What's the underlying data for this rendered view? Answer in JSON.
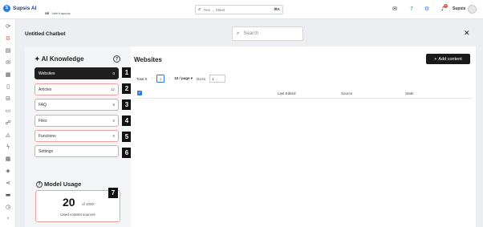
{
  "topbar": {
    "brand": "Supsis AI",
    "workspace_prefix": "SE",
    "workspace_name": "Vale Kapsula",
    "search_placeholder": "Yeni → Etiket",
    "search_shortcut": "⌘K",
    "notification_count": "8",
    "username": "Supsis"
  },
  "page": {
    "title": "Untitled Chatbot",
    "search_placeholder": "Search"
  },
  "knowledge": {
    "title": "AI Knowledge",
    "items": [
      {
        "label": "Websites",
        "count": "0"
      },
      {
        "label": "Articles",
        "count": "12"
      },
      {
        "label": "FAQ",
        "count": "8"
      },
      {
        "label": "Files",
        "count": "0"
      },
      {
        "label": "Functions",
        "count": "0"
      },
      {
        "label": "Settings",
        "count": ""
      }
    ]
  },
  "usage": {
    "title": "Model Usage",
    "used": "20",
    "of_text": "of 1000",
    "caption": "Used content sources"
  },
  "markers": [
    "1",
    "2",
    "3",
    "4",
    "5",
    "6",
    "7"
  ],
  "websites": {
    "title": "Websites",
    "add_label": "Add content",
    "total_label": "Total 0",
    "current_page": "1",
    "page_size": "10 / page",
    "goto_label": "Go to",
    "goto_value": "1",
    "columns": [
      "Last Edited",
      "Source",
      "State"
    ]
  },
  "colors": {
    "accent": "#2c7be5",
    "highlight": "#f1a0a0",
    "active_item": "#1f1f1f",
    "notification": "#e0523c"
  }
}
